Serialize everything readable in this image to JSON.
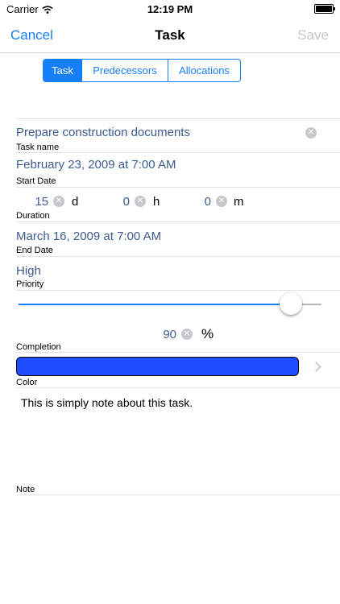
{
  "status_bar": {
    "carrier": "Carrier",
    "time": "12:19 PM",
    "wifi_icon": "wifi-icon",
    "battery_icon": "battery-icon"
  },
  "nav": {
    "cancel": "Cancel",
    "title": "Task",
    "save": "Save"
  },
  "tabs": [
    {
      "label": "Task",
      "selected": true
    },
    {
      "label": "Predecessors",
      "selected": false
    },
    {
      "label": "Allocations",
      "selected": false
    }
  ],
  "task_name": {
    "value": "Prepare construction documents",
    "label": "Task name"
  },
  "start_date": {
    "value": "February 23, 2009 at 7:00 AM",
    "label": "Start Date"
  },
  "duration": {
    "label": "Duration",
    "days": "15",
    "days_unit": "d",
    "hours": "0",
    "hours_unit": "h",
    "minutes": "0",
    "minutes_unit": "m"
  },
  "end_date": {
    "value": "March 16, 2009 at 7:00 AM",
    "label": "End Date"
  },
  "priority": {
    "value": "High",
    "label": "Priority"
  },
  "completion": {
    "value": "90",
    "unit": "%",
    "label": "Completion",
    "slider_fraction": 0.9
  },
  "color": {
    "label": "Color",
    "value": "#1f4cff"
  },
  "note": {
    "text": "This is simply note about this task.",
    "label": "Note"
  },
  "colors": {
    "accent": "#157efb",
    "value_text": "#3e5b8f",
    "disabled": "#c7c7cc"
  }
}
